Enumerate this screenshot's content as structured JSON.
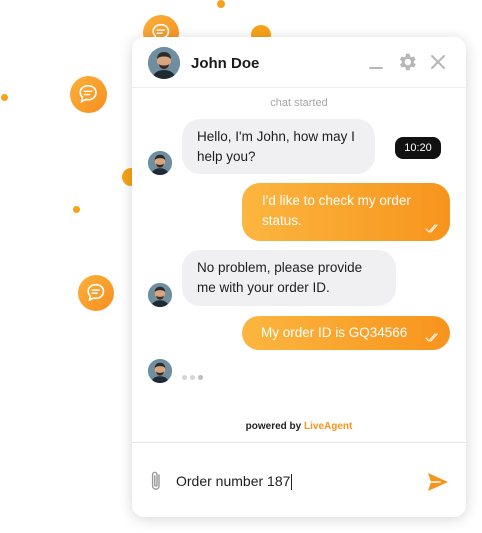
{
  "header": {
    "agent_name": "John Doe",
    "minimize_icon": "minimize-icon",
    "settings_icon": "gear-icon",
    "close_icon": "close-icon"
  },
  "status_text": "chat started",
  "messages": [
    {
      "direction": "incoming",
      "text": "Hello, I'm John, how may I help you?",
      "time": "10:20"
    },
    {
      "direction": "outgoing",
      "text": "I'd like to check my order status.",
      "status_icon": "double-check-icon"
    },
    {
      "direction": "incoming",
      "text": "No problem, please provide me with your order ID."
    },
    {
      "direction": "outgoing",
      "text": "My order ID is GQ34566",
      "status_icon": "double-check-icon"
    }
  ],
  "typing_indicator": "typing-dots",
  "footer": {
    "powered_prefix": "powered by",
    "powered_brand": "LiveAgent"
  },
  "composer": {
    "input_value": "Order number 187",
    "attach_icon": "paperclip-icon",
    "send_icon": "send-icon"
  },
  "colors": {
    "accent": "#f7941d",
    "accent_light": "#fbb63f",
    "incoming_bubble": "#f0f0f2",
    "time_badge": "#111111"
  }
}
